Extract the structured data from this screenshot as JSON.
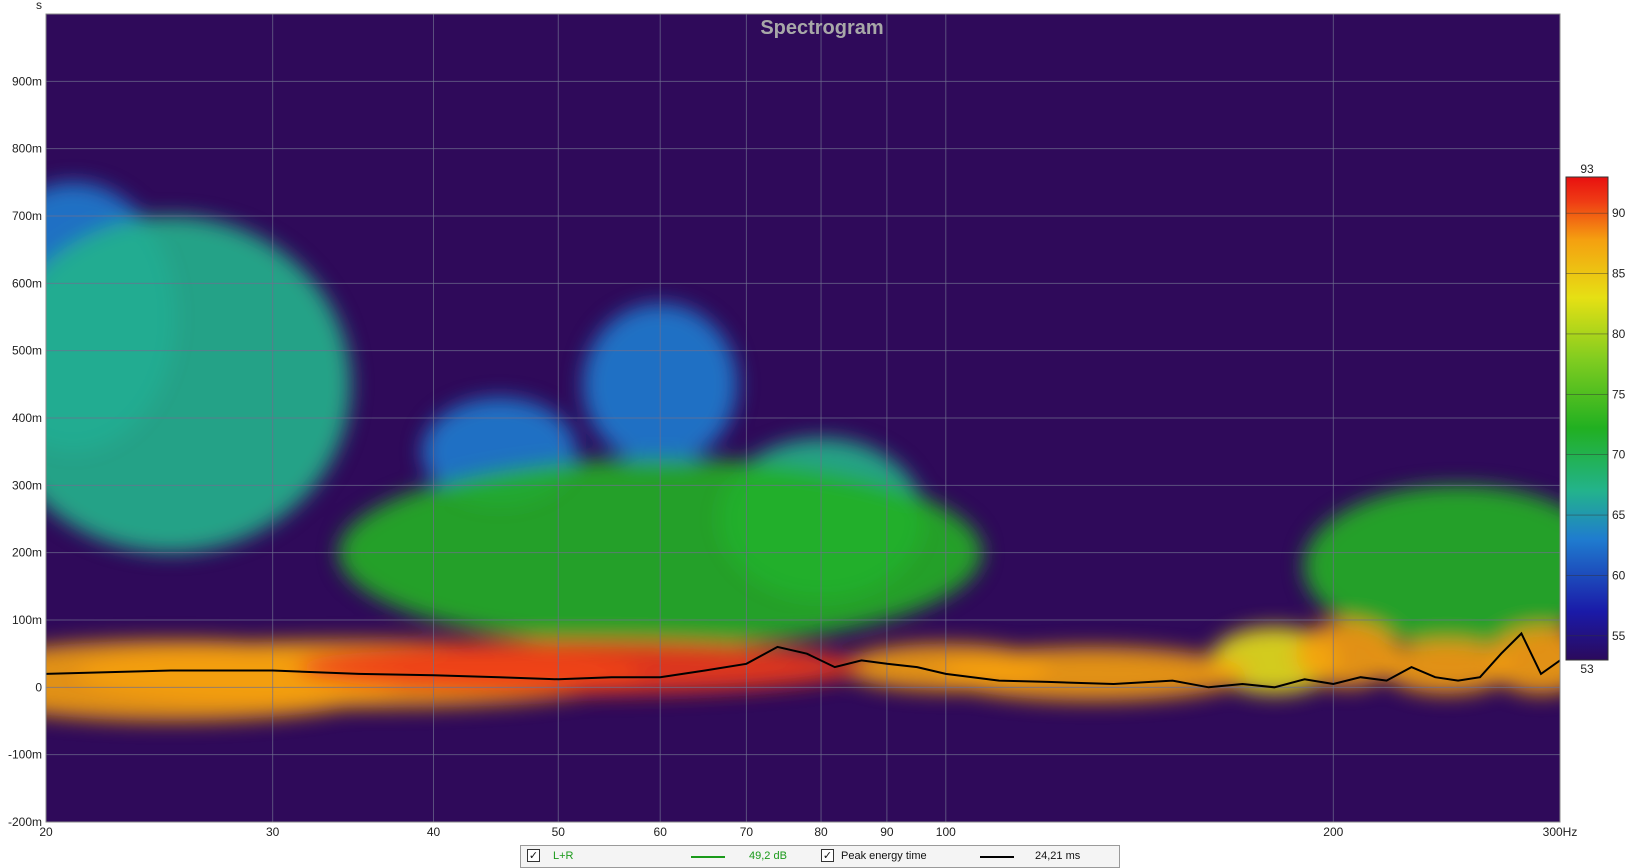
{
  "chart_data": {
    "type": "heatmap",
    "title": "Spectrogram",
    "ylabel": "s",
    "x_scale": "log",
    "xlim": [
      20,
      300
    ],
    "ylim": [
      -0.2,
      1.0
    ],
    "x_ticks": [
      {
        "value": 20,
        "label": "20"
      },
      {
        "value": 30,
        "label": "30"
      },
      {
        "value": 40,
        "label": "40"
      },
      {
        "value": 50,
        "label": "50"
      },
      {
        "value": 60,
        "label": "60"
      },
      {
        "value": 70,
        "label": "70"
      },
      {
        "value": 80,
        "label": "80"
      },
      {
        "value": 90,
        "label": "90"
      },
      {
        "value": 100,
        "label": "100"
      },
      {
        "value": 200,
        "label": "200"
      },
      {
        "value": 300,
        "label": "300Hz"
      }
    ],
    "y_ticks": [
      {
        "value": 0.9,
        "label": "900m"
      },
      {
        "value": 0.8,
        "label": "800m"
      },
      {
        "value": 0.7,
        "label": "700m"
      },
      {
        "value": 0.6,
        "label": "600m"
      },
      {
        "value": 0.5,
        "label": "500m"
      },
      {
        "value": 0.4,
        "label": "400m"
      },
      {
        "value": 0.3,
        "label": "300m"
      },
      {
        "value": 0.2,
        "label": "200m"
      },
      {
        "value": 0.1,
        "label": "100m"
      },
      {
        "value": 0.0,
        "label": "0"
      },
      {
        "value": -0.1,
        "label": "-100m"
      },
      {
        "value": -0.2,
        "label": "-200m"
      }
    ],
    "grid": true,
    "colorbar": {
      "min": 53,
      "max": 93,
      "min_label": "53",
      "max_label": "93",
      "ticks": [
        {
          "value": 90,
          "label": "90"
        },
        {
          "value": 85,
          "label": "85"
        },
        {
          "value": 80,
          "label": "80"
        },
        {
          "value": 75,
          "label": "75"
        },
        {
          "value": 70,
          "label": "70"
        },
        {
          "value": 65,
          "label": "65"
        },
        {
          "value": 60,
          "label": "60"
        },
        {
          "value": 55,
          "label": "55"
        }
      ],
      "colors": [
        "#2b0a5c",
        "#1a1aa8",
        "#1f7ccf",
        "#23b38c",
        "#21b021",
        "#7fcc20",
        "#e6e014",
        "#f5a010",
        "#ef3b14",
        "#e81010"
      ]
    },
    "background_color": "#2f0a5a",
    "peak_energy_time_curve": {
      "x": [
        20,
        25,
        30,
        35,
        40,
        45,
        50,
        55,
        60,
        65,
        70,
        74,
        78,
        82,
        86,
        90,
        95,
        100,
        110,
        120,
        135,
        150,
        160,
        170,
        180,
        190,
        200,
        210,
        220,
        230,
        240,
        250,
        260,
        270,
        280,
        290,
        300
      ],
      "y": [
        0.02,
        0.025,
        0.025,
        0.02,
        0.018,
        0.015,
        0.012,
        0.015,
        0.015,
        0.025,
        0.035,
        0.06,
        0.05,
        0.03,
        0.04,
        0.035,
        0.03,
        0.02,
        0.01,
        0.008,
        0.005,
        0.01,
        0.0,
        0.005,
        0.0,
        0.012,
        0.005,
        0.015,
        0.01,
        0.03,
        0.015,
        0.01,
        0.015,
        0.05,
        0.08,
        0.02,
        0.04
      ]
    },
    "energy_blobs": [
      {
        "x": 52,
        "y": 0.03,
        "sx": 0.22,
        "sy": 0.04,
        "level": 90
      },
      {
        "x": 35,
        "y": 0.02,
        "sx": 0.22,
        "sy": 0.05,
        "level": 86
      },
      {
        "x": 25,
        "y": 0.01,
        "sx": 0.18,
        "sy": 0.06,
        "level": 83
      },
      {
        "x": 100,
        "y": 0.03,
        "sx": 0.08,
        "sy": 0.035,
        "level": 82
      },
      {
        "x": 130,
        "y": 0.02,
        "sx": 0.12,
        "sy": 0.04,
        "level": 84
      },
      {
        "x": 180,
        "y": 0.04,
        "sx": 0.05,
        "sy": 0.05,
        "level": 81
      },
      {
        "x": 205,
        "y": 0.05,
        "sx": 0.04,
        "sy": 0.05,
        "level": 85
      },
      {
        "x": 245,
        "y": 0.03,
        "sx": 0.05,
        "sy": 0.04,
        "level": 86
      },
      {
        "x": 290,
        "y": 0.04,
        "sx": 0.04,
        "sy": 0.05,
        "level": 82
      },
      {
        "x": 60,
        "y": 0.2,
        "sx": 0.25,
        "sy": 0.14,
        "level": 72
      },
      {
        "x": 25,
        "y": 0.45,
        "sx": 0.14,
        "sy": 0.25,
        "level": 65
      },
      {
        "x": 21,
        "y": 0.55,
        "sx": 0.08,
        "sy": 0.2,
        "level": 62
      },
      {
        "x": 80,
        "y": 0.25,
        "sx": 0.08,
        "sy": 0.12,
        "level": 68
      },
      {
        "x": 60,
        "y": 0.45,
        "sx": 0.06,
        "sy": 0.12,
        "level": 62
      },
      {
        "x": 250,
        "y": 0.18,
        "sx": 0.12,
        "sy": 0.12,
        "level": 70
      },
      {
        "x": 45,
        "y": 0.35,
        "sx": 0.06,
        "sy": 0.08,
        "level": 62
      }
    ],
    "series": [
      {
        "name": "L+R",
        "value_label": "49,2 dB",
        "color": "#1a9a1a",
        "checked": true
      },
      {
        "name": "Peak energy time",
        "value_label": "24,21 ms",
        "color": "#000000",
        "checked": true
      }
    ]
  }
}
